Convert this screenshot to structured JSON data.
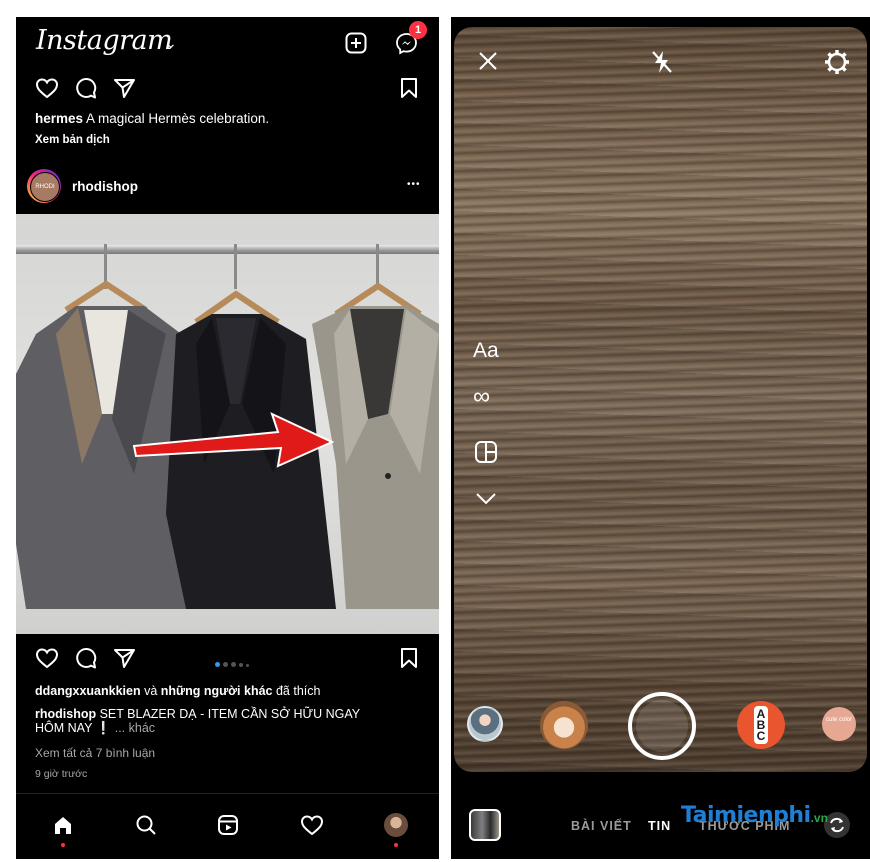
{
  "feed": {
    "app_title": "Instagram",
    "messenger_badge": "1",
    "prev_post": {
      "username": "hermes",
      "caption": "A magical Hermès celebration.",
      "translate_link": "Xem bản dịch"
    },
    "post": {
      "avatar_text": "RHODI",
      "username": "rhodishop",
      "more": "•••",
      "liked_user": "ddangxxuankkien",
      "liked_and": "và",
      "liked_others": "những người khác",
      "liked_suffix": "đã thích",
      "caption_user": "rhodishop",
      "caption_line1": "SET BLAZER DẠ - ITEM CẦN SỞ HỮU NGAY",
      "caption_line2": "HÔM NAY",
      "caption_emoji": "❕",
      "caption_more": "... khác",
      "view_comments": "Xem tất cả 7 bình luận",
      "time": "9 giờ trước",
      "carousel": {
        "count": 5,
        "active": 1
      }
    },
    "nav": [
      "home",
      "search",
      "reels",
      "activity",
      "profile"
    ]
  },
  "camera": {
    "tools": [
      "Aa",
      "∞"
    ],
    "effects_note": "ABC",
    "effect5_text": "cute color",
    "modes": {
      "post": "BÀI VIẾT",
      "story": "TIN",
      "reels": "THƯỚC PHIM"
    }
  },
  "watermark": {
    "brand": "Taimienphi",
    "suffix": ".vn"
  },
  "colors": {
    "accent": "#3897f0",
    "badge": "#ff3040",
    "arrow": "#e01919"
  }
}
